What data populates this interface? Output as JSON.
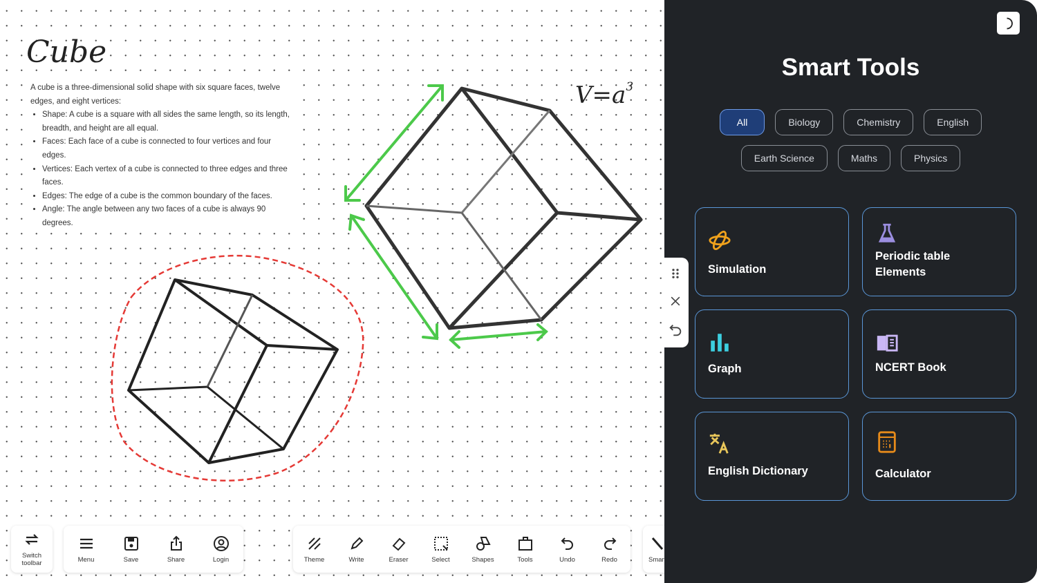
{
  "canvas": {
    "title": "Cube",
    "intro": "A cube is a three-dimensional solid shape with six square faces, twelve edges, and eight vertices:",
    "bullets": [
      "Shape: A cube is a square with all sides the same length, so its length, breadth, and height are all equal.",
      "Faces: Each face of a cube is connected to four vertices and four edges.",
      "Vertices: Each vertex of a cube is connected to three edges and three faces.",
      "Edges: The edge of a cube is the common boundary of the faces.",
      "Angle: The angle between any two faces of a cube is always 90 degrees."
    ],
    "formula": "V=a",
    "formula_exp": "3",
    "colors": {
      "arrow": "#4cc94a",
      "lasso": "#e53935",
      "stroke": "#2b2b2b"
    }
  },
  "toolbar": {
    "switch": "Switch toolbar",
    "group1": [
      "Menu",
      "Save",
      "Share",
      "Login"
    ],
    "group2": [
      "Theme",
      "Write",
      "Eraser",
      "Select",
      "Shapes",
      "Tools",
      "Undo",
      "Redo"
    ],
    "smart": "Smart"
  },
  "panel": {
    "title": "Smart Tools",
    "filters": [
      "All",
      "Biology",
      "Chemistry",
      "English",
      "Earth Science",
      "Maths",
      "Physics"
    ],
    "active_filter": "All",
    "cards": [
      {
        "label": "Simulation",
        "icon": "atom-icon",
        "color": "#f0a21c"
      },
      {
        "label": "Periodic table Elements",
        "icon": "flask-icon",
        "color": "#9b8ee0"
      },
      {
        "label": "Graph",
        "icon": "bar-chart-icon",
        "color": "#3ccfe0"
      },
      {
        "label": "NCERT Book",
        "icon": "book-icon",
        "color": "#c9b7f5"
      },
      {
        "label": "English Dictionary",
        "icon": "translate-icon",
        "color": "#e8c65a"
      },
      {
        "label": "Calculator",
        "icon": "calculator-icon",
        "color": "#e58a1a"
      }
    ]
  }
}
